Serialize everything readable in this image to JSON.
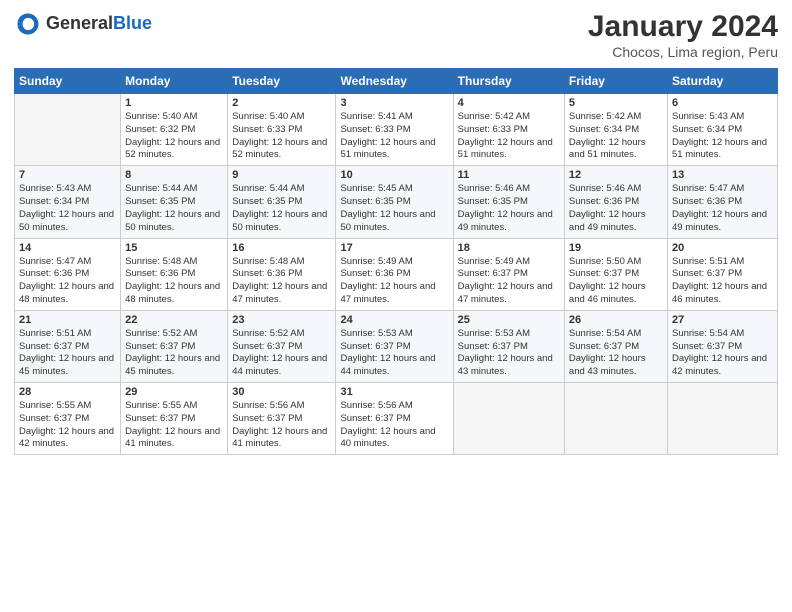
{
  "header": {
    "logo_general": "General",
    "logo_blue": "Blue",
    "month_title": "January 2024",
    "subtitle": "Chocos, Lima region, Peru"
  },
  "columns": [
    "Sunday",
    "Monday",
    "Tuesday",
    "Wednesday",
    "Thursday",
    "Friday",
    "Saturday"
  ],
  "weeks": [
    [
      {
        "day": "",
        "sunrise": "",
        "sunset": "",
        "daylight": ""
      },
      {
        "day": "1",
        "sunrise": "Sunrise: 5:40 AM",
        "sunset": "Sunset: 6:32 PM",
        "daylight": "Daylight: 12 hours and 52 minutes."
      },
      {
        "day": "2",
        "sunrise": "Sunrise: 5:40 AM",
        "sunset": "Sunset: 6:33 PM",
        "daylight": "Daylight: 12 hours and 52 minutes."
      },
      {
        "day": "3",
        "sunrise": "Sunrise: 5:41 AM",
        "sunset": "Sunset: 6:33 PM",
        "daylight": "Daylight: 12 hours and 51 minutes."
      },
      {
        "day": "4",
        "sunrise": "Sunrise: 5:42 AM",
        "sunset": "Sunset: 6:33 PM",
        "daylight": "Daylight: 12 hours and 51 minutes."
      },
      {
        "day": "5",
        "sunrise": "Sunrise: 5:42 AM",
        "sunset": "Sunset: 6:34 PM",
        "daylight": "Daylight: 12 hours and 51 minutes."
      },
      {
        "day": "6",
        "sunrise": "Sunrise: 5:43 AM",
        "sunset": "Sunset: 6:34 PM",
        "daylight": "Daylight: 12 hours and 51 minutes."
      }
    ],
    [
      {
        "day": "7",
        "sunrise": "Sunrise: 5:43 AM",
        "sunset": "Sunset: 6:34 PM",
        "daylight": "Daylight: 12 hours and 50 minutes."
      },
      {
        "day": "8",
        "sunrise": "Sunrise: 5:44 AM",
        "sunset": "Sunset: 6:35 PM",
        "daylight": "Daylight: 12 hours and 50 minutes."
      },
      {
        "day": "9",
        "sunrise": "Sunrise: 5:44 AM",
        "sunset": "Sunset: 6:35 PM",
        "daylight": "Daylight: 12 hours and 50 minutes."
      },
      {
        "day": "10",
        "sunrise": "Sunrise: 5:45 AM",
        "sunset": "Sunset: 6:35 PM",
        "daylight": "Daylight: 12 hours and 50 minutes."
      },
      {
        "day": "11",
        "sunrise": "Sunrise: 5:46 AM",
        "sunset": "Sunset: 6:35 PM",
        "daylight": "Daylight: 12 hours and 49 minutes."
      },
      {
        "day": "12",
        "sunrise": "Sunrise: 5:46 AM",
        "sunset": "Sunset: 6:36 PM",
        "daylight": "Daylight: 12 hours and 49 minutes."
      },
      {
        "day": "13",
        "sunrise": "Sunrise: 5:47 AM",
        "sunset": "Sunset: 6:36 PM",
        "daylight": "Daylight: 12 hours and 49 minutes."
      }
    ],
    [
      {
        "day": "14",
        "sunrise": "Sunrise: 5:47 AM",
        "sunset": "Sunset: 6:36 PM",
        "daylight": "Daylight: 12 hours and 48 minutes."
      },
      {
        "day": "15",
        "sunrise": "Sunrise: 5:48 AM",
        "sunset": "Sunset: 6:36 PM",
        "daylight": "Daylight: 12 hours and 48 minutes."
      },
      {
        "day": "16",
        "sunrise": "Sunrise: 5:48 AM",
        "sunset": "Sunset: 6:36 PM",
        "daylight": "Daylight: 12 hours and 47 minutes."
      },
      {
        "day": "17",
        "sunrise": "Sunrise: 5:49 AM",
        "sunset": "Sunset: 6:36 PM",
        "daylight": "Daylight: 12 hours and 47 minutes."
      },
      {
        "day": "18",
        "sunrise": "Sunrise: 5:49 AM",
        "sunset": "Sunset: 6:37 PM",
        "daylight": "Daylight: 12 hours and 47 minutes."
      },
      {
        "day": "19",
        "sunrise": "Sunrise: 5:50 AM",
        "sunset": "Sunset: 6:37 PM",
        "daylight": "Daylight: 12 hours and 46 minutes."
      },
      {
        "day": "20",
        "sunrise": "Sunrise: 5:51 AM",
        "sunset": "Sunset: 6:37 PM",
        "daylight": "Daylight: 12 hours and 46 minutes."
      }
    ],
    [
      {
        "day": "21",
        "sunrise": "Sunrise: 5:51 AM",
        "sunset": "Sunset: 6:37 PM",
        "daylight": "Daylight: 12 hours and 45 minutes."
      },
      {
        "day": "22",
        "sunrise": "Sunrise: 5:52 AM",
        "sunset": "Sunset: 6:37 PM",
        "daylight": "Daylight: 12 hours and 45 minutes."
      },
      {
        "day": "23",
        "sunrise": "Sunrise: 5:52 AM",
        "sunset": "Sunset: 6:37 PM",
        "daylight": "Daylight: 12 hours and 44 minutes."
      },
      {
        "day": "24",
        "sunrise": "Sunrise: 5:53 AM",
        "sunset": "Sunset: 6:37 PM",
        "daylight": "Daylight: 12 hours and 44 minutes."
      },
      {
        "day": "25",
        "sunrise": "Sunrise: 5:53 AM",
        "sunset": "Sunset: 6:37 PM",
        "daylight": "Daylight: 12 hours and 43 minutes."
      },
      {
        "day": "26",
        "sunrise": "Sunrise: 5:54 AM",
        "sunset": "Sunset: 6:37 PM",
        "daylight": "Daylight: 12 hours and 43 minutes."
      },
      {
        "day": "27",
        "sunrise": "Sunrise: 5:54 AM",
        "sunset": "Sunset: 6:37 PM",
        "daylight": "Daylight: 12 hours and 42 minutes."
      }
    ],
    [
      {
        "day": "28",
        "sunrise": "Sunrise: 5:55 AM",
        "sunset": "Sunset: 6:37 PM",
        "daylight": "Daylight: 12 hours and 42 minutes."
      },
      {
        "day": "29",
        "sunrise": "Sunrise: 5:55 AM",
        "sunset": "Sunset: 6:37 PM",
        "daylight": "Daylight: 12 hours and 41 minutes."
      },
      {
        "day": "30",
        "sunrise": "Sunrise: 5:56 AM",
        "sunset": "Sunset: 6:37 PM",
        "daylight": "Daylight: 12 hours and 41 minutes."
      },
      {
        "day": "31",
        "sunrise": "Sunrise: 5:56 AM",
        "sunset": "Sunset: 6:37 PM",
        "daylight": "Daylight: 12 hours and 40 minutes."
      },
      {
        "day": "",
        "sunrise": "",
        "sunset": "",
        "daylight": ""
      },
      {
        "day": "",
        "sunrise": "",
        "sunset": "",
        "daylight": ""
      },
      {
        "day": "",
        "sunrise": "",
        "sunset": "",
        "daylight": ""
      }
    ]
  ]
}
